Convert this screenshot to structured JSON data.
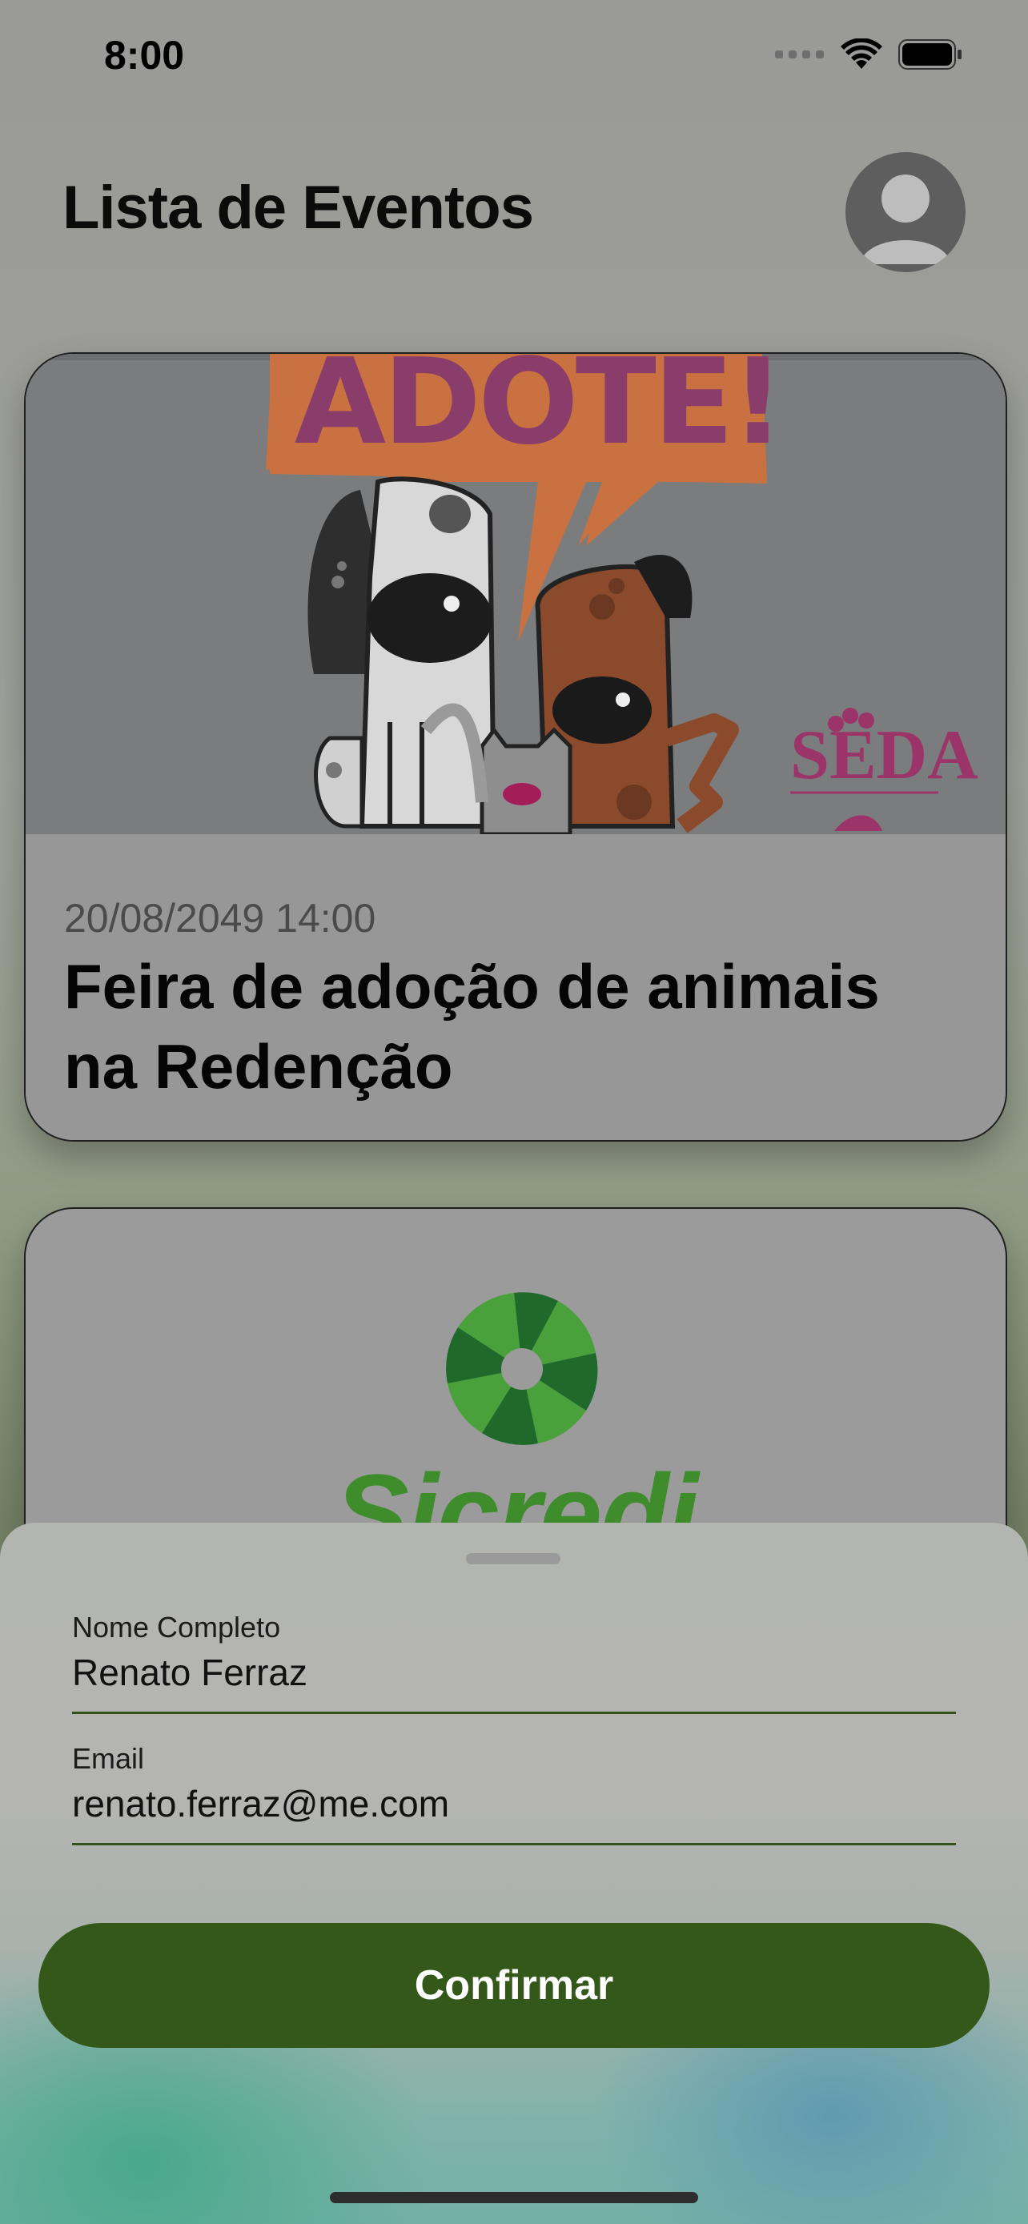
{
  "status_bar": {
    "time": "8:00"
  },
  "header": {
    "title": "Lista de Eventos"
  },
  "events": [
    {
      "poster_text": "ADOTE!",
      "date": "20/08/2049 14:00",
      "title": "Feira de adoção de animais na Redenção",
      "logo_text": "SEDA"
    },
    {
      "logo_text": "Sicredi"
    }
  ],
  "form": {
    "name_label": "Nome Completo",
    "name_value": "Renato Ferraz",
    "email_label": "Email",
    "email_value": "renato.ferraz@me.com",
    "confirm_label": "Confirmar"
  },
  "colors": {
    "accent_green": "#345819",
    "field_underline": "#34511b"
  }
}
